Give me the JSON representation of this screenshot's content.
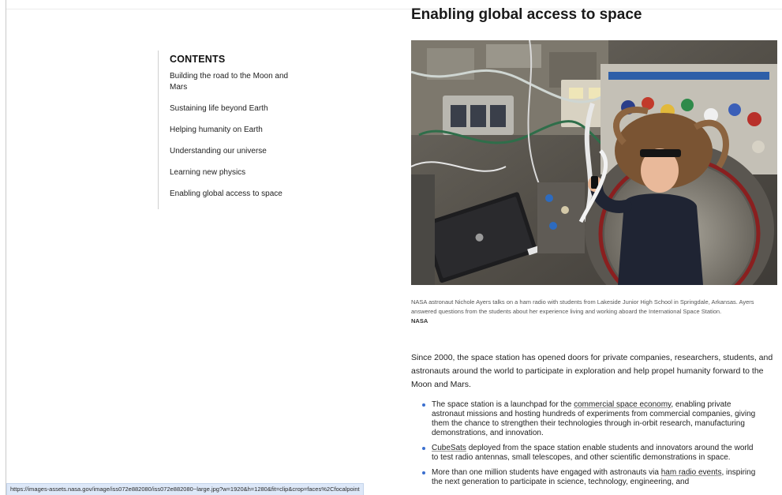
{
  "toc": {
    "heading": "CONTENTS",
    "items": [
      {
        "label": "Building the road to the Moon and Mars"
      },
      {
        "label": "Sustaining life beyond Earth"
      },
      {
        "label": "Helping humanity on Earth"
      },
      {
        "label": "Understanding our universe"
      },
      {
        "label": "Learning new physics"
      },
      {
        "label": "Enabling global access to space"
      }
    ]
  },
  "section": {
    "title": "Enabling global access to space",
    "image_alt": "NASA astronaut Nichole Ayers talks on a ham radio aboard the International Space Station",
    "caption": "NASA astronaut Nichole Ayers talks on a ham radio with students from Lakeside Junior High School in Springdale, Arkansas. Ayers answered questions from the students about her experience living and working aboard the International Space Station.",
    "caption_credit": "NASA",
    "intro": "Since 2000, the space station has opened doors for private companies, researchers, students, and astronauts around the world to participate in exploration and help propel humanity forward to the Moon and Mars.",
    "bullets": [
      {
        "before": "The space station is a launchpad for the ",
        "link": "commercial space economy",
        "after": ", enabling private astronaut missions and hosting hundreds of experiments from commercial companies, giving them the chance to strengthen their technologies through in-orbit research, manufacturing demonstrations, and innovation."
      },
      {
        "before": "",
        "link": "CubeSats",
        "after": " deployed from the space station enable students and innovators around the world to test radio antennas, small telescopes, and other scientific demonstrations in space."
      },
      {
        "before": "More than one million students have engaged with astronauts via ",
        "link": "ham radio events",
        "after": ", inspiring the next generation to participate in science, technology, engineering, and"
      }
    ]
  },
  "status_bar": {
    "url": "https://images-assets.nasa.gov/image/iss072e882080/iss072e882080~large.jpg?w=1920&h=1280&fit=clip&crop=faces%2Cfocalpoint"
  },
  "colors": {
    "bullet_marker": "#3b6fcf",
    "status_bar_bg": "#dde8f8"
  }
}
